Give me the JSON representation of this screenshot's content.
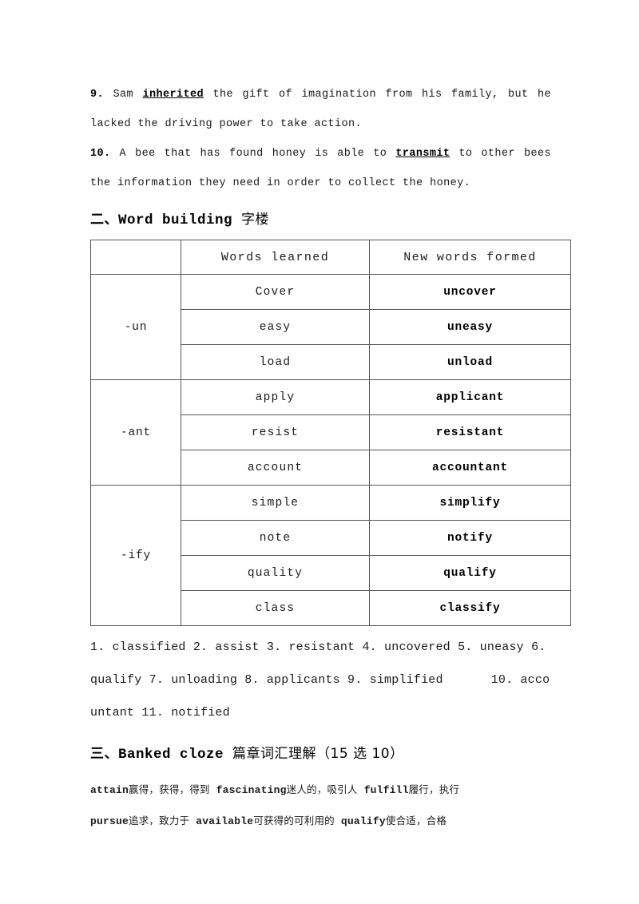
{
  "document": {
    "exercises": [
      {
        "number": "9.",
        "before": "Sam",
        "keyword": "inherited",
        "after": "the gift of imagination from his family, but he lacked the driving power to take action."
      },
      {
        "number": "10.",
        "before": "A bee that has found honey is able to",
        "keyword": "transmit",
        "after": "to other bees the information they need in order to collect the honey."
      }
    ],
    "word_building": {
      "heading_index": "二、",
      "heading_en": "Word building",
      "heading_cn": "字楼",
      "columns": {
        "affix": "",
        "learned": "Words  learned",
        "formed": "New words formed"
      },
      "groups": [
        {
          "affix": "-un",
          "rows": [
            {
              "learned": "Cover",
              "formed": "uncover"
            },
            {
              "learned": "easy",
              "formed": "uneasy"
            },
            {
              "learned": "load",
              "formed": "unload"
            }
          ]
        },
        {
          "affix": "-ant",
          "rows": [
            {
              "learned": "apply",
              "formed": "applicant"
            },
            {
              "learned": "resist",
              "formed": "resistant"
            },
            {
              "learned": "account",
              "formed": "accountant"
            }
          ]
        },
        {
          "affix": "-ify",
          "rows": [
            {
              "learned": "simple",
              "formed": "simplify"
            },
            {
              "learned": "note",
              "formed": "notify"
            },
            {
              "learned": "quality",
              "formed": "qualify"
            },
            {
              "learned": "class",
              "formed": "classify"
            }
          ]
        }
      ],
      "answer_key": {
        "part1": "1. classified 2. assist 3. resistant  4. uncovered  5. uneasy  6. qualify 7. unloading 8. applicants 9. simplified",
        "part2": "10. accountant 11. notified"
      }
    },
    "banked_cloze": {
      "heading_index": "三、",
      "heading_en": "Banked cloze",
      "heading_cn": "篇章词汇理解（15 选 10）",
      "vocabulary_lines": [
        [
          {
            "en": "attain",
            "cn": "赢得，获得，得到"
          },
          {
            "en": "fascinating",
            "cn": "迷人的，吸引人"
          },
          {
            "en": "fulfill",
            "cn": "履行，执行"
          }
        ],
        [
          {
            "en": "pursue",
            "cn": "追求，致力于"
          },
          {
            "en": "available",
            "cn": "可获得的可利用的"
          },
          {
            "en": "qualify",
            "cn": "使合适，合格"
          }
        ]
      ]
    }
  }
}
